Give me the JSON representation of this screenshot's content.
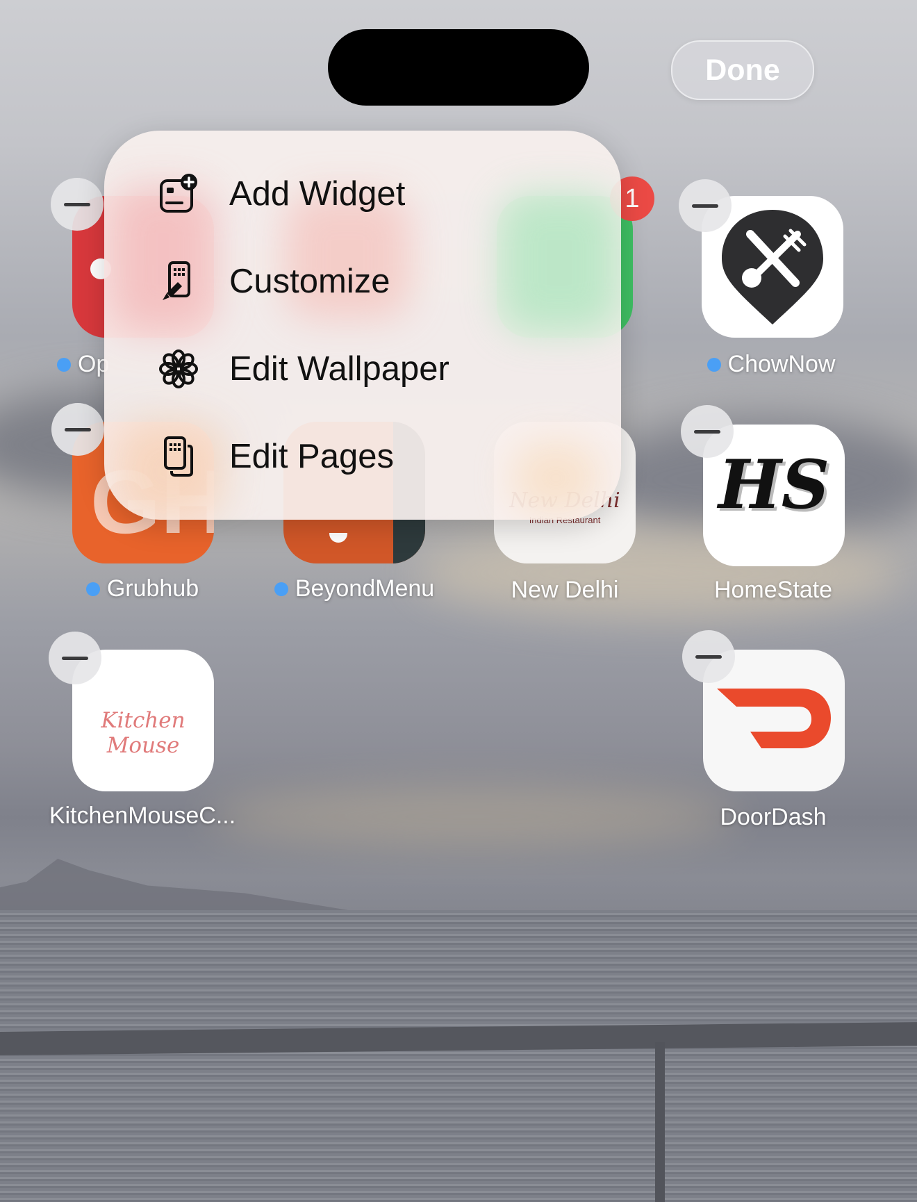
{
  "header": {
    "done_label": "Done"
  },
  "menu": {
    "items": [
      {
        "label": "Add Widget",
        "icon": "add-widget-icon"
      },
      {
        "label": "Customize",
        "icon": "customize-brush-icon"
      },
      {
        "label": "Edit Wallpaper",
        "icon": "flower-icon"
      },
      {
        "label": "Edit Pages",
        "icon": "pages-icon"
      }
    ]
  },
  "apps": {
    "row1": [
      {
        "label": "Op",
        "dot": true,
        "icon": "red-app-icon"
      },
      {
        "label": "ChowNow",
        "dot": true,
        "icon": "chownow-logo"
      }
    ],
    "row1_badge": "1",
    "row2": [
      {
        "label": "Grubhub",
        "dot": true,
        "icon_text": "GH"
      },
      {
        "label": "BeyondMenu",
        "dot": true,
        "icon": "beyondmenu-logo"
      },
      {
        "label": "New Delhi",
        "dot": false,
        "icon_text": "New Delhi",
        "icon_subtext": "Indian Restaurant"
      },
      {
        "label": "HomeState",
        "dot": false,
        "icon_text": "HS"
      }
    ],
    "row3": [
      {
        "label": "KitchenMouseC...",
        "dot": false,
        "icon_text": "Kitchen Mouse"
      },
      {
        "label": "DoorDash",
        "dot": false,
        "icon": "doordash-logo"
      }
    ]
  },
  "colors": {
    "accent_dot": "#4a9ff5",
    "badge": "#eb4a45",
    "grubhub": "#e8632b",
    "doordash": "#ea4a2c"
  }
}
